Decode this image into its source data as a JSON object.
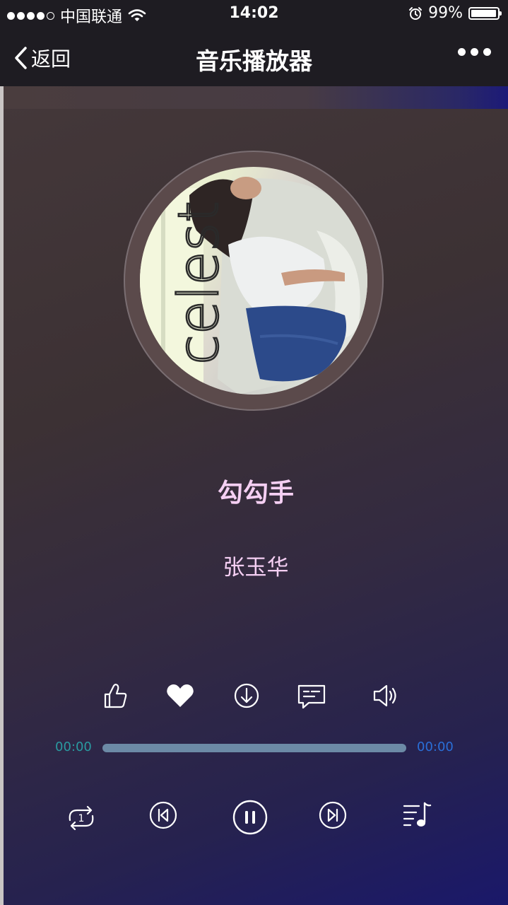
{
  "status": {
    "carrier": "中国联通",
    "time": "14:02",
    "battery": "99%"
  },
  "nav": {
    "back_label": "返回",
    "title": "音乐播放器"
  },
  "song": {
    "title": "勾勾手",
    "artist": "张玉华",
    "cover_text": "celest"
  },
  "progress": {
    "current": "00:00",
    "total": "00:00",
    "fraction": 0
  },
  "actions": [
    "like-icon",
    "favorite-heart-icon",
    "download-icon",
    "comment-icon",
    "volume-icon"
  ],
  "controls": [
    "repeat-one-icon",
    "previous-icon",
    "pause-icon",
    "next-icon",
    "playlist-icon"
  ],
  "colors": {
    "title_pink": "#f5cff3",
    "time_current": "#2a9aa0",
    "time_total": "#2a6fd8",
    "bar": "#6c8aa6"
  }
}
